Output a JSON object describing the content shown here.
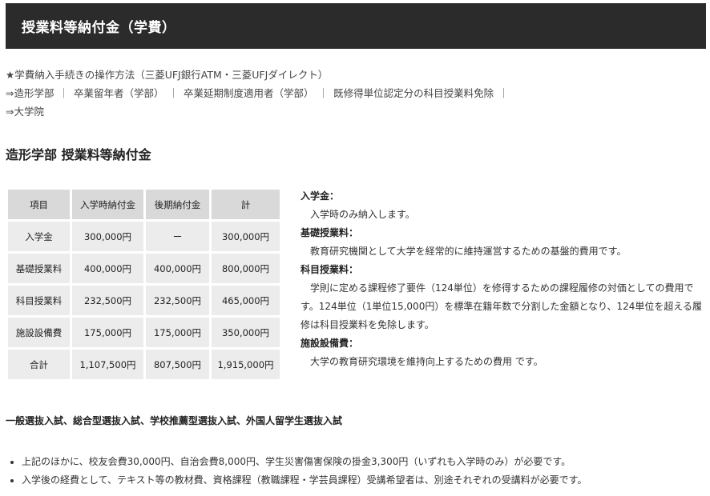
{
  "header": {
    "title": "授業料等納付金（学費）"
  },
  "nav": {
    "procedure_link": "★学費納入手続きの操作方法（三菱UFJ銀行ATM・三菱UFJダイレクト）",
    "separator": "｜",
    "items": [
      "⇒造形学部",
      "卒業留年者（学部）",
      "卒業延期制度適用者（学部）",
      "既修得単位認定分の科目授業料免除"
    ],
    "grad_link": "⇒大学院"
  },
  "section": {
    "title": "造形学部 授業料等納付金"
  },
  "table": {
    "headers": [
      "項目",
      "入学時納付金",
      "後期納付金",
      "計"
    ],
    "rows": [
      [
        "入学金",
        "300,000円",
        "ー",
        "300,000円"
      ],
      [
        "基礎授業料",
        "400,000円",
        "400,000円",
        "800,000円"
      ],
      [
        "科目授業料",
        "232,500円",
        "232,500円",
        "465,000円"
      ],
      [
        "施設設備費",
        "175,000円",
        "175,000円",
        "350,000円"
      ],
      [
        "合計",
        "1,107,500円",
        "807,500円",
        "1,915,000円"
      ]
    ]
  },
  "descriptions": [
    {
      "term": "入学金：",
      "text": "入学時のみ納入します。"
    },
    {
      "term": "基礎授業料：",
      "text": "教育研究機関として大学を経常的に維持運営するための基盤的費用です。"
    },
    {
      "term": "科目授業料：",
      "text": "学則に定める課程修了要件（124単位）を修得するための課程履修の対価としての費用です。124単位（1単位15,000円）を標準在籍年数で分割した金額となり、124単位を超える履修は科目授業料を免除します。"
    },
    {
      "term": "施設設備費：",
      "text": "大学の教育研究環境を維持向上するための費用 です。"
    }
  ],
  "notes": {
    "heading": "一般選抜入試、総合型選抜入試、学校推薦型選抜入試、外国人留学生選抜入試",
    "items": [
      "上記のほかに、校友会費30,000円、自治会費8,000円、学生災害傷害保険の掛金3,300円（いずれも入学時のみ）が必要です。",
      "入学後の経費として、テキスト等の教材費、資格課程（教職課程・学芸員課程）受講希望者は、別途それぞれの受講料が必要です。"
    ]
  }
}
